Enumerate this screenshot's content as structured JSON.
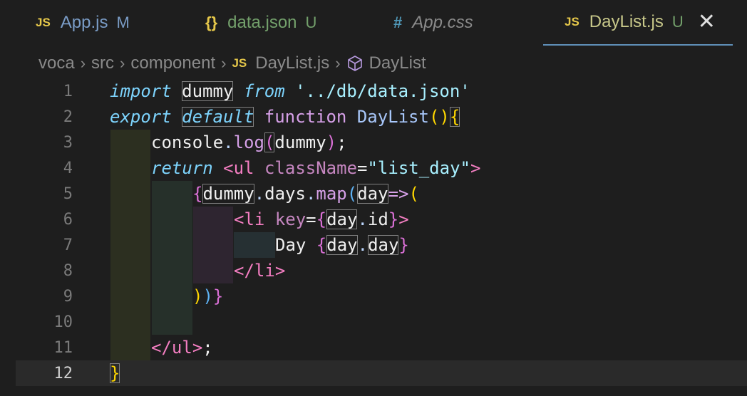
{
  "tabs": [
    {
      "icon": "JS",
      "label": "App.js",
      "status": "M",
      "active": false
    },
    {
      "icon": "{}",
      "label": "data.json",
      "status": "U",
      "active": false
    },
    {
      "icon": "#",
      "label": "App.css",
      "status": "",
      "active": false
    },
    {
      "icon": "JS",
      "label": "DayList.js",
      "status": "U",
      "active": true
    }
  ],
  "breadcrumb": {
    "items": [
      "voca",
      "src",
      "component",
      "DayList.js",
      "DayList"
    ],
    "file_icon": "JS"
  },
  "editor": {
    "line_numbers": [
      "1",
      "2",
      "3",
      "4",
      "5",
      "6",
      "7",
      "8",
      "9",
      "10",
      "11",
      "12"
    ],
    "active_line": "12"
  },
  "code": {
    "l1": {
      "import": "import",
      "name": "dummy",
      "from": "from",
      "path": "'../db/data.json'"
    },
    "l2": {
      "export": "export",
      "default": "default",
      "function": "function",
      "fname": "DayList",
      "parens": "()",
      "brace": "{"
    },
    "l3": {
      "console": "console",
      "dot": ".",
      "log": "log",
      "open": "(",
      "arg": "dummy",
      "close": ")",
      "semi": ";"
    },
    "l4": {
      "return": "return",
      "lt": "<",
      "tag": "ul",
      "attr": "className",
      "eq": "=",
      "val": "\"list_day\"",
      "gt": ">"
    },
    "l5": {
      "brace": "{",
      "obj": "dummy",
      "dot1": ".",
      "prop": "days",
      "dot2": ".",
      "map": "map",
      "open": "(",
      "param": "day",
      "arrow": "=>",
      "open2": "("
    },
    "l6": {
      "lt": "<",
      "tag": "li",
      "attr": "key",
      "eq": "=",
      "brace_open": "{",
      "obj": "day",
      "dot": ".",
      "prop": "id",
      "brace_close": "}",
      "gt": ">"
    },
    "l7": {
      "text": "Day ",
      "brace_open": "{",
      "obj": "day",
      "dot": ".",
      "prop": "day",
      "brace_close": "}"
    },
    "l8": {
      "lt": "</",
      "tag": "li",
      "gt": ">"
    },
    "l9": {
      "close1": ")",
      "close2": ")",
      "brace": "}"
    },
    "l11": {
      "lt": "</",
      "tag": "ul",
      "gt": ">",
      "semi": ";"
    },
    "l12": {
      "brace": "}"
    }
  },
  "colors": {
    "background": "#1e1e1e",
    "js_icon": "#e6c84a",
    "css_icon": "#519aba",
    "modified": "#7a9cc6",
    "untracked": "#73c991",
    "active_tab_border": "#5f8fb8"
  }
}
